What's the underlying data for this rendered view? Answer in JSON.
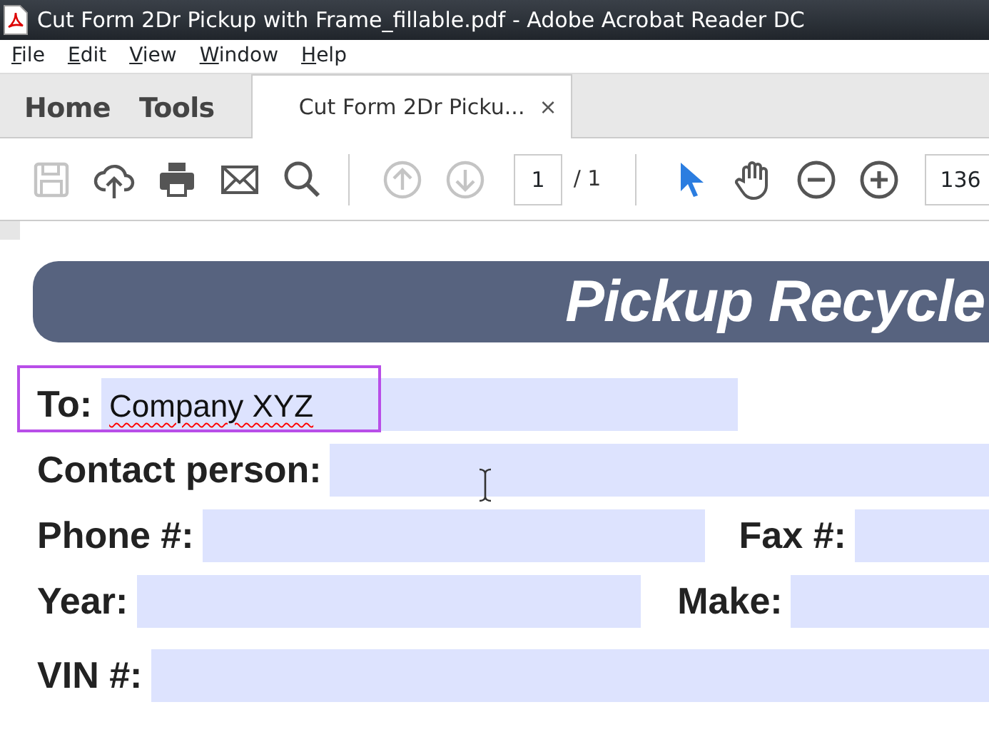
{
  "window": {
    "title": "Cut Form 2Dr Pickup with Frame_fillable.pdf - Adobe Acrobat Reader DC"
  },
  "menu": [
    "File",
    "Edit",
    "View",
    "Window",
    "Help"
  ],
  "nav": [
    "Home",
    "Tools"
  ],
  "tabs": [
    {
      "label": "Cut Form 2Dr Picku...",
      "close": "×",
      "selected": true
    }
  ],
  "toolbar": {
    "tools": [
      {
        "kind": "save",
        "disabled": true
      },
      {
        "kind": "upload",
        "disabled": false
      },
      {
        "kind": "print",
        "disabled": false
      },
      {
        "kind": "mail",
        "disabled": false
      },
      {
        "kind": "search",
        "disabled": false
      },
      {
        "kind": "sep"
      },
      {
        "kind": "up",
        "disabled": true
      },
      {
        "kind": "down",
        "disabled": true
      },
      {
        "kind": "page"
      },
      {
        "kind": "sep"
      },
      {
        "kind": "pointer",
        "disabled": false,
        "selected": true
      },
      {
        "kind": "hand",
        "disabled": false,
        "selected": false
      },
      {
        "kind": "zoomout",
        "disabled": false
      },
      {
        "kind": "zoomin",
        "disabled": false
      },
      {
        "kind": "zoom"
      }
    ],
    "page": "1",
    "page_total": "/ 1",
    "zoom": "136"
  },
  "document": {
    "heading": "Pickup Recycle",
    "rows": [
      [
        {
          "label": "To:",
          "value": "Company XYZ",
          "focused": true
        }
      ],
      [
        {
          "label": "Contact person:",
          "focused": false
        }
      ],
      [
        {
          "label": "Phone #:",
          "focused": false
        },
        {
          "label": "Fax #:",
          "focused": false
        }
      ],
      [
        {
          "label": "Year:",
          "focused": false
        },
        {
          "label": "Make:",
          "focused": false
        }
      ],
      [
        {
          "label": "VIN #:",
          "focused": false
        }
      ]
    ]
  }
}
